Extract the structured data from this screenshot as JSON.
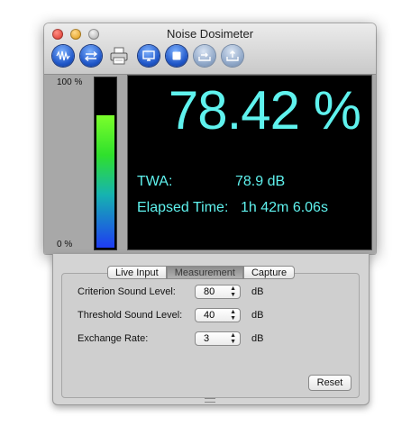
{
  "window": {
    "title": "Noise Dosimeter"
  },
  "toolbar": {
    "buttons": [
      {
        "icon": "waveform-icon"
      },
      {
        "icon": "settings-swap-icon"
      },
      {
        "icon": "printer-icon"
      },
      {
        "icon": "display-icon"
      },
      {
        "icon": "stop-icon"
      },
      {
        "icon": "export-icon"
      },
      {
        "icon": "import-icon"
      }
    ]
  },
  "meter": {
    "scale_top": "100  %",
    "scale_bottom": "0  %",
    "level_fraction": 0.78,
    "dose": "78.42 %",
    "twa_label": "TWA:",
    "twa_value": "78.9 dB",
    "elapsed_label": "Elapsed Time:",
    "elapsed_value": "1h 42m 6.06s"
  },
  "tabs": [
    {
      "label": "Live Input",
      "selected": false
    },
    {
      "label": "Measurement",
      "selected": true
    },
    {
      "label": "Capture",
      "selected": false
    }
  ],
  "measurement": {
    "criterion_label": "Criterion Sound Level:",
    "criterion_value": "80",
    "threshold_label": "Threshold Sound Level:",
    "threshold_value": "40",
    "exchange_label": "Exchange Rate:",
    "exchange_value": "3",
    "unit": "dB",
    "reset_label": "Reset"
  },
  "colors": {
    "display_text": "#5ff2ee",
    "display_background": "#000000",
    "toolbar_blue": "#1f56c8"
  }
}
